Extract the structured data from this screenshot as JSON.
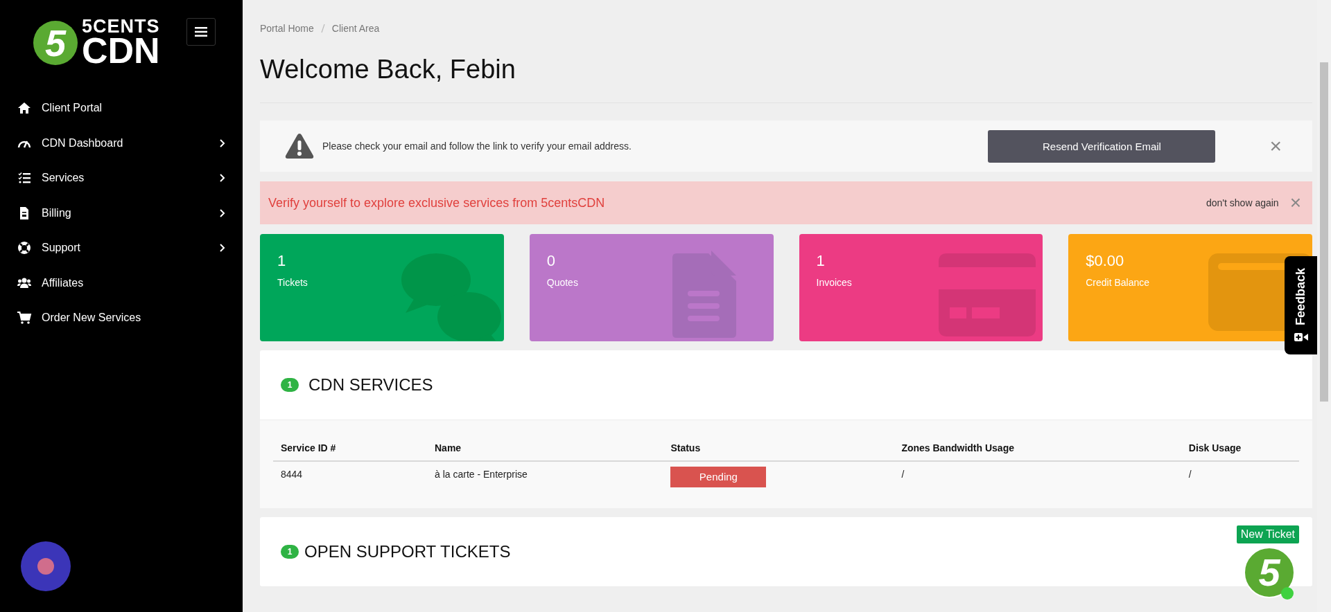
{
  "logo": {
    "mark": "5",
    "line_1": "5CENTS",
    "line_2": "CDN"
  },
  "sidebar": {
    "items": [
      {
        "label": "Client Portal",
        "kind": "home",
        "expandable": false
      },
      {
        "label": "CDN Dashboard",
        "kind": "gauge",
        "expandable": true
      },
      {
        "label": "Services",
        "kind": "list",
        "expandable": true
      },
      {
        "label": "Billing",
        "kind": "doc",
        "expandable": true
      },
      {
        "label": "Support",
        "kind": "lifebuoy",
        "expandable": true
      },
      {
        "label": "Affiliates",
        "kind": "users",
        "expandable": false
      },
      {
        "label": "Order New Services",
        "kind": "cart",
        "expandable": false
      }
    ]
  },
  "breadcrumb": [
    "Portal Home",
    "Client Area"
  ],
  "title": "Welcome Back, Febin",
  "email_alert": {
    "message": "Please check your email and follow the link to verify your email address.",
    "button": "Resend Verification Email",
    "close": "×"
  },
  "verify_banner": {
    "message": "Verify yourself to explore exclusive services from 5centsCDN",
    "dismiss": "don't show again",
    "close": "×"
  },
  "stats": [
    {
      "value": "1",
      "label": "Tickets",
      "kind": "chat",
      "color": "#00a65a"
    },
    {
      "value": "0",
      "label": "Quotes",
      "kind": "doc",
      "color": "#bb77c9"
    },
    {
      "value": "1",
      "label": "Invoices",
      "kind": "card",
      "color": "#ec3b83"
    },
    {
      "value": "$0.00",
      "label": "Credit Balance",
      "kind": "wallet",
      "color": "#fca614"
    }
  ],
  "services": {
    "count": "1",
    "title": "CDN SERVICES",
    "columns": [
      "Service ID #",
      "Name",
      "Status",
      "Zones Bandwidth Usage",
      "Disk Usage"
    ],
    "rows": [
      {
        "id": "8444",
        "name": "à la carte - Enterprise",
        "status": "Pending",
        "bandwidth": "/",
        "disk": "/"
      }
    ]
  },
  "tickets": {
    "count": "1",
    "title": "OPEN SUPPORT TICKETS",
    "button": "New Ticket"
  },
  "feedback": {
    "label": "Feedback"
  },
  "chat_bubble": {
    "mark": "5",
    "online": true
  }
}
